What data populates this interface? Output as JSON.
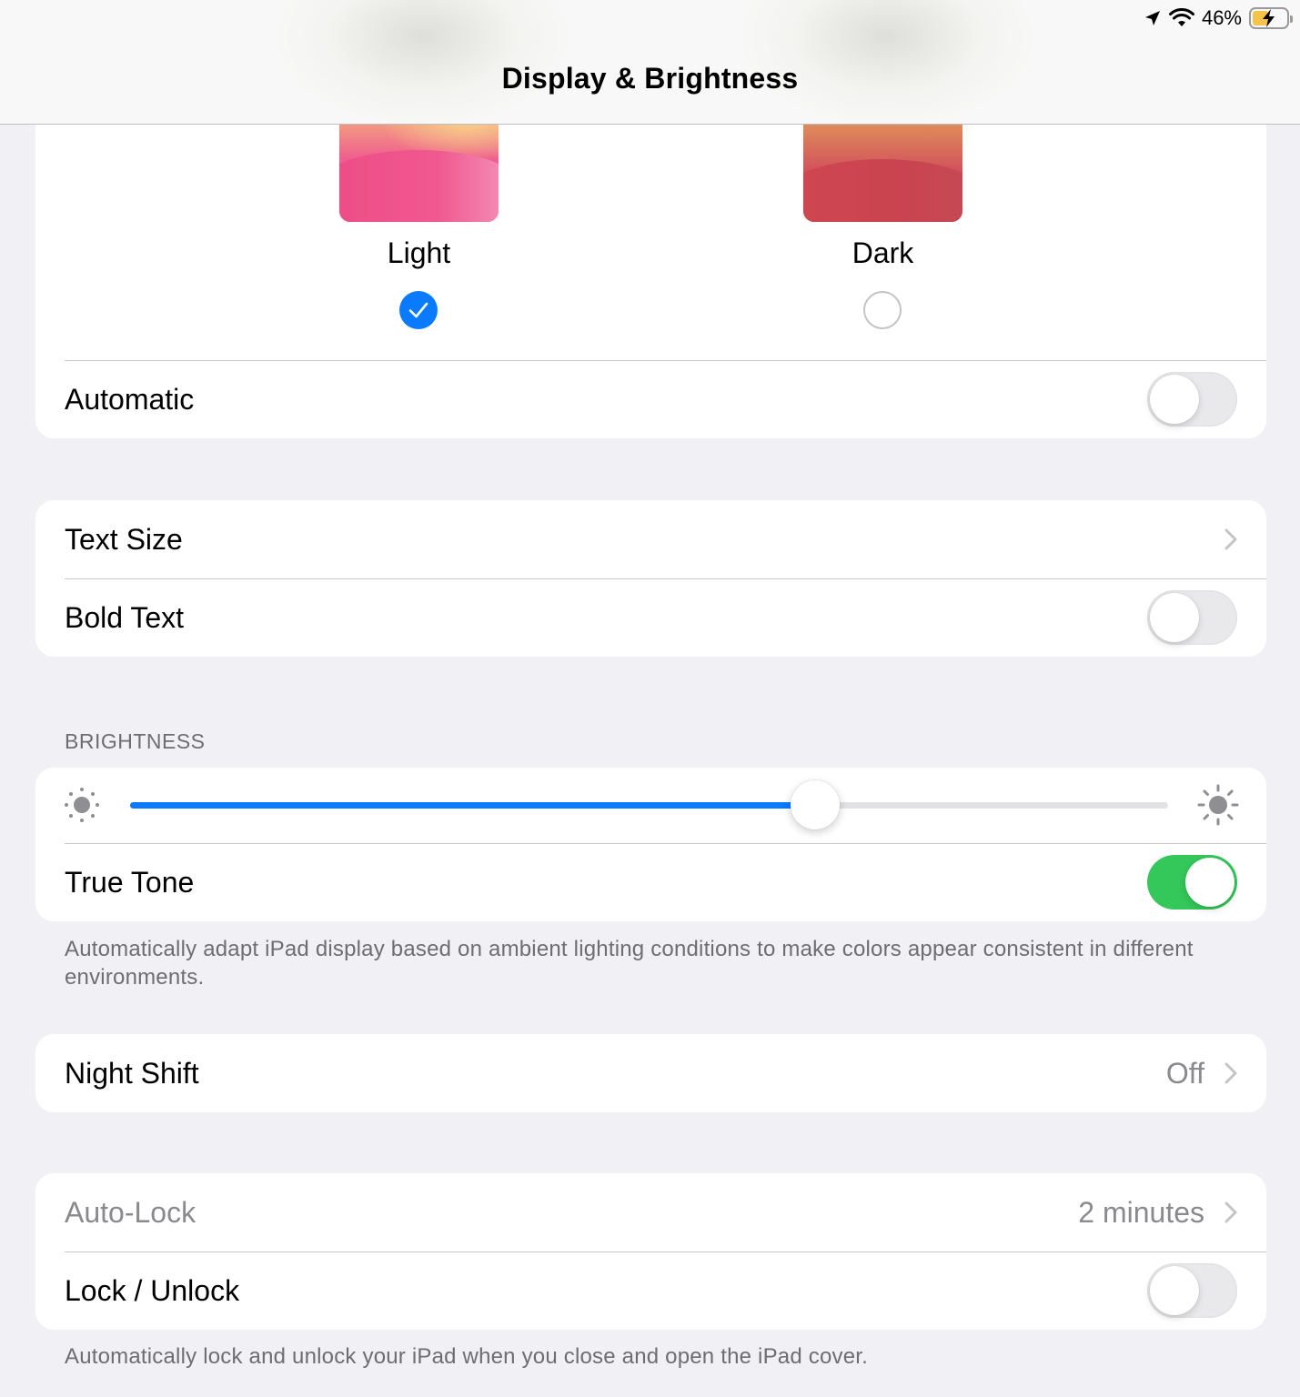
{
  "header": {
    "title": "Display & Brightness",
    "battery_percent": "46%",
    "battery_level": 0.46,
    "icons": [
      "location-arrow-icon",
      "wifi-icon",
      "battery-charging-icon"
    ]
  },
  "appearance": {
    "options": [
      {
        "label": "Light",
        "selected": true
      },
      {
        "label": "Dark",
        "selected": false
      }
    ],
    "automatic": {
      "label": "Automatic",
      "on": false
    }
  },
  "text": {
    "text_size": {
      "label": "Text Size"
    },
    "bold_text": {
      "label": "Bold Text",
      "on": false
    }
  },
  "brightness": {
    "section_header": "BRIGHTNESS",
    "level": 0.66,
    "true_tone": {
      "label": "True Tone",
      "on": true
    },
    "footer": "Automatically adapt iPad display based on ambient lighting conditions to make colors appear consistent in different environments."
  },
  "night_shift": {
    "label": "Night Shift",
    "value": "Off"
  },
  "lock": {
    "auto_lock": {
      "label": "Auto-Lock",
      "value": "2 minutes"
    },
    "lock_unlock": {
      "label": "Lock / Unlock",
      "on": false
    },
    "footer": "Automatically lock and unlock your iPad when you close and open the iPad cover."
  },
  "colors": {
    "accent": "#0a7aff",
    "toggle_on": "#34c759",
    "background": "#f0f0f5"
  }
}
